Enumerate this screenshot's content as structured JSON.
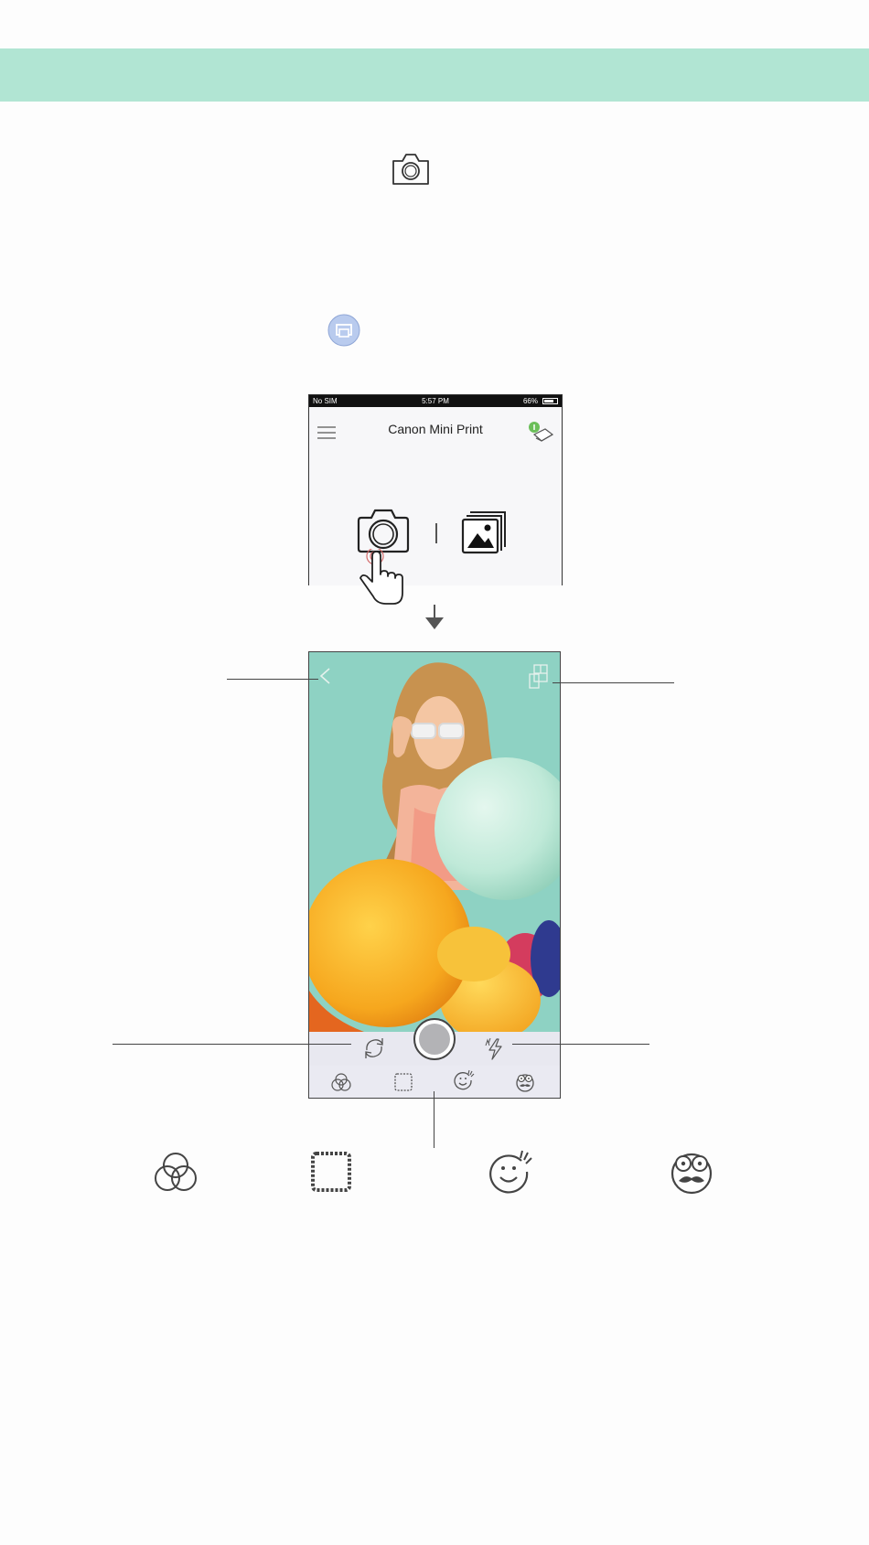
{
  "status_bar": {
    "carrier": "No SIM",
    "time": "5:57 PM",
    "battery": "66%"
  },
  "app": {
    "title": "Canon Mini Print"
  },
  "colors": {
    "banner": "#b1e5d3",
    "printer_badge": "#b9cbee",
    "control_bar": "#e8e8f0"
  },
  "icons": {
    "top": "camera-icon",
    "badge": "printer-icon",
    "home": [
      "camera-icon",
      "gallery-icon"
    ],
    "camera_toolbar": [
      "filters-icon",
      "frames-icon",
      "stickers-icon",
      "face-masks-icon"
    ],
    "legend": [
      "filters-icon",
      "frames-icon",
      "stickers-icon",
      "face-masks-icon"
    ]
  }
}
